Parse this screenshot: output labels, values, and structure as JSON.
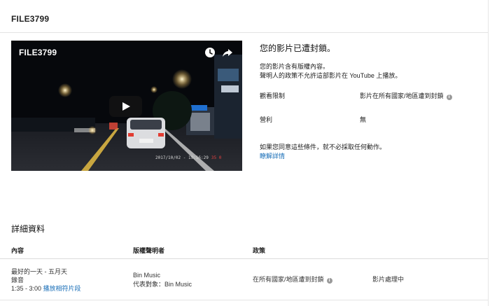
{
  "page": {
    "title": "FILE3799"
  },
  "video": {
    "overlay_title": "FILE3799",
    "timestamp": "2017/10/02 - 19:16:29",
    "speed": "35 0",
    "icons": [
      "clock-icon",
      "share-icon",
      "play-icon"
    ]
  },
  "block_notice": {
    "title": "您的影片已遭封鎖。",
    "line1": "您的影片含有版權內容。",
    "line2": "聲明人的政策不允許這部影片在 YouTube 上播放。",
    "rows": [
      {
        "label": "觀看限制",
        "value": "影片在所有國家/地區遭到封鎖",
        "has_info": true
      },
      {
        "label": "營利",
        "value": "無",
        "has_info": false
      }
    ],
    "footer": "如果您同意這些條件，就不必採取任何動作。",
    "learn_more": "瞭解詳情"
  },
  "details": {
    "title": "詳細資料",
    "headers": {
      "content": "內容",
      "claimant": "版權聲明者",
      "policy": "政策"
    },
    "row": {
      "song": "最好的一天 - 五月天",
      "type": "錄音",
      "range": "1:35 - 3:00",
      "play_link": "播放相符片段",
      "claimant": "Bin Music",
      "on_behalf": "代表對象：Bin Music",
      "policy": "在所有國家/地區遭到封鎖",
      "status": "影片處理中"
    }
  },
  "colors": {
    "link": "#1a6fb8",
    "info_icon": "#9a9a9a"
  }
}
